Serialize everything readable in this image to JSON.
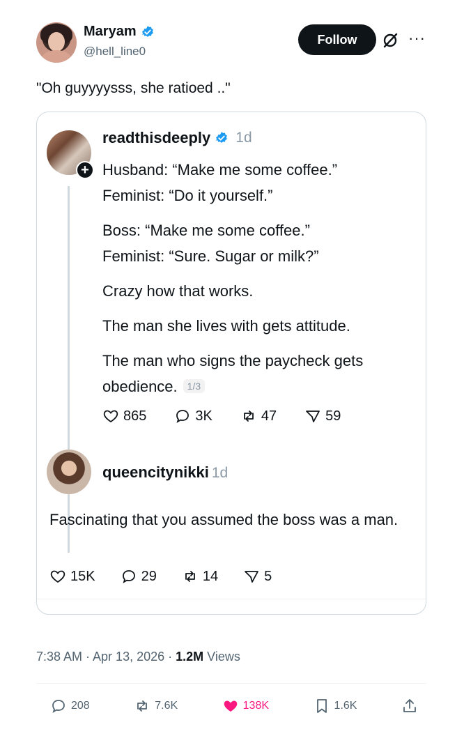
{
  "author": {
    "display_name": "Maryam",
    "handle": "@hell_line0",
    "follow_label": "Follow"
  },
  "tweet": {
    "text": "\"Oh guyyyysss, she ratioed ..\""
  },
  "quoted": {
    "author": "readthisdeeply",
    "time": "1d",
    "lines": [
      "Husband: “Make me some coffee.”",
      "Feminist: “Do it yourself.”",
      "Boss: “Make me some coffee.”",
      "Feminist: “Sure. Sugar or milk?”",
      "Crazy how that works.",
      "The man she lives with gets attitude.",
      "The man who signs the paycheck gets obedience."
    ],
    "page": "1/3",
    "likes": "865",
    "replies": "3K",
    "reposts": "47",
    "shares": "59"
  },
  "reply": {
    "author": "queencitynikki",
    "time": "1d",
    "text": "Fascinating that you assumed the boss was a man.",
    "likes": "15K",
    "replies": "29",
    "reposts": "14",
    "shares": "5"
  },
  "meta": {
    "timestamp": "7:38 AM · Apr 13, 2026 · ",
    "views": "1.2M",
    "views_label": " Views"
  },
  "stats": {
    "replies": "208",
    "reposts": "7.6K",
    "likes": "138K",
    "bookmarks": "1.6K"
  },
  "colors": {
    "like_active": "#f91880",
    "verified": "#1d9bf0"
  }
}
